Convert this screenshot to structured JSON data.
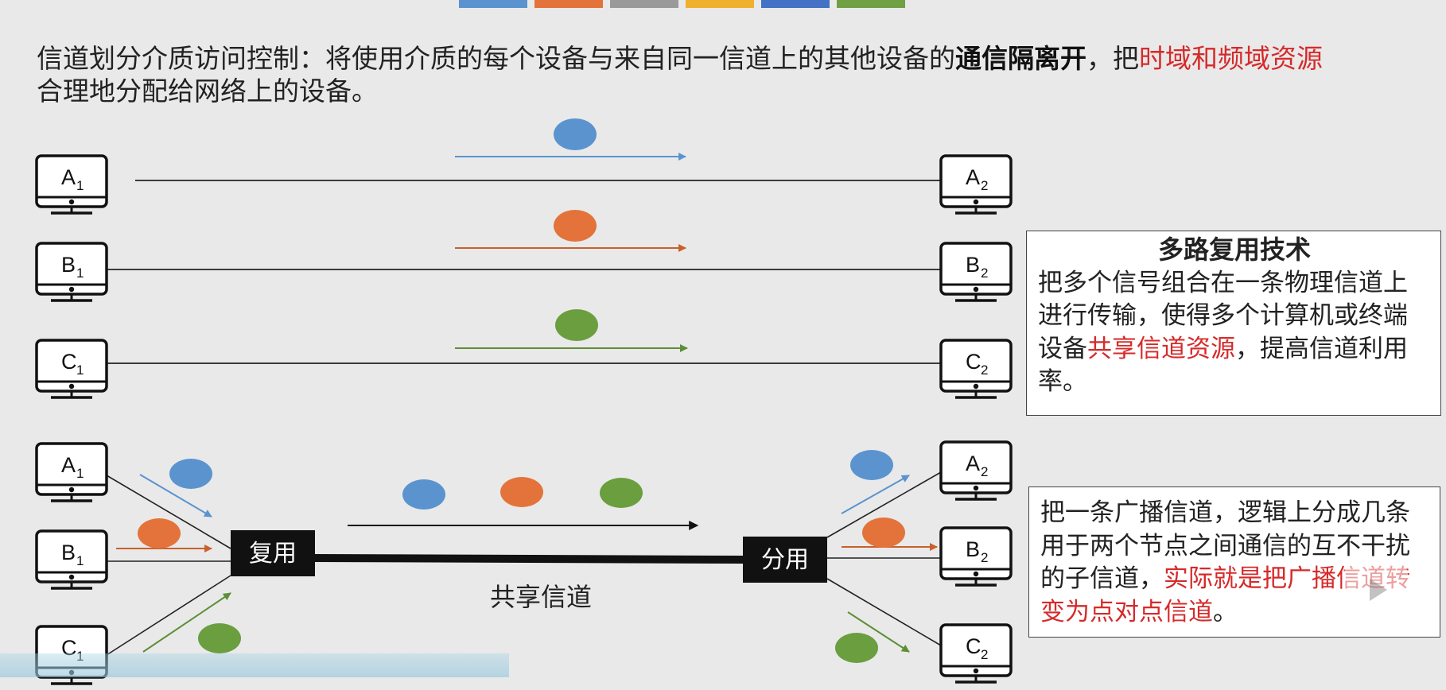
{
  "colors": {
    "blue": "#5b93cf",
    "orange": "#e3733a",
    "green": "#6a9e3f",
    "red": "#d62a2a",
    "top_bar": [
      "#5b93cf",
      "#e3733a",
      "#9a9a9a",
      "#f0b030",
      "#4472c4",
      "#70a044"
    ]
  },
  "intro": {
    "part1": "信道划分介质访问控制：将使用介质的每个设备与来自同一信道上的其他设备的",
    "bold": "通信隔离开",
    "part2": "，把",
    "red": "时域和频域资源",
    "part3": "合理地分配给网络上的设备。"
  },
  "top_diagram": {
    "left_nodes": [
      {
        "letter": "A",
        "sub": "1"
      },
      {
        "letter": "B",
        "sub": "1"
      },
      {
        "letter": "C",
        "sub": "1"
      }
    ],
    "right_nodes": [
      {
        "letter": "A",
        "sub": "2"
      },
      {
        "letter": "B",
        "sub": "2"
      },
      {
        "letter": "C",
        "sub": "2"
      }
    ]
  },
  "bottom_diagram": {
    "left_nodes": [
      {
        "letter": "A",
        "sub": "1"
      },
      {
        "letter": "B",
        "sub": "1"
      },
      {
        "letter": "C",
        "sub": "1"
      }
    ],
    "right_nodes": [
      {
        "letter": "A",
        "sub": "2"
      },
      {
        "letter": "B",
        "sub": "2"
      },
      {
        "letter": "C",
        "sub": "2"
      }
    ],
    "mux_label": "复用",
    "demux_label": "分用",
    "channel_label": "共享信道"
  },
  "multiplex_box": {
    "title": "多路复用技术",
    "text1": "把多个信号组合在一条物理信道上进行传输，使得多个计算机或终端设备",
    "red": "共享信道资源",
    "text2": "，提高信道利用率。"
  },
  "logic_box": {
    "text1": "把一条广播信道，逻辑上分成几条用于两个节点之间通信的互不干扰的子信道，",
    "red": "实际就是把广播信道转变为点对点信道",
    "text2": "。"
  }
}
